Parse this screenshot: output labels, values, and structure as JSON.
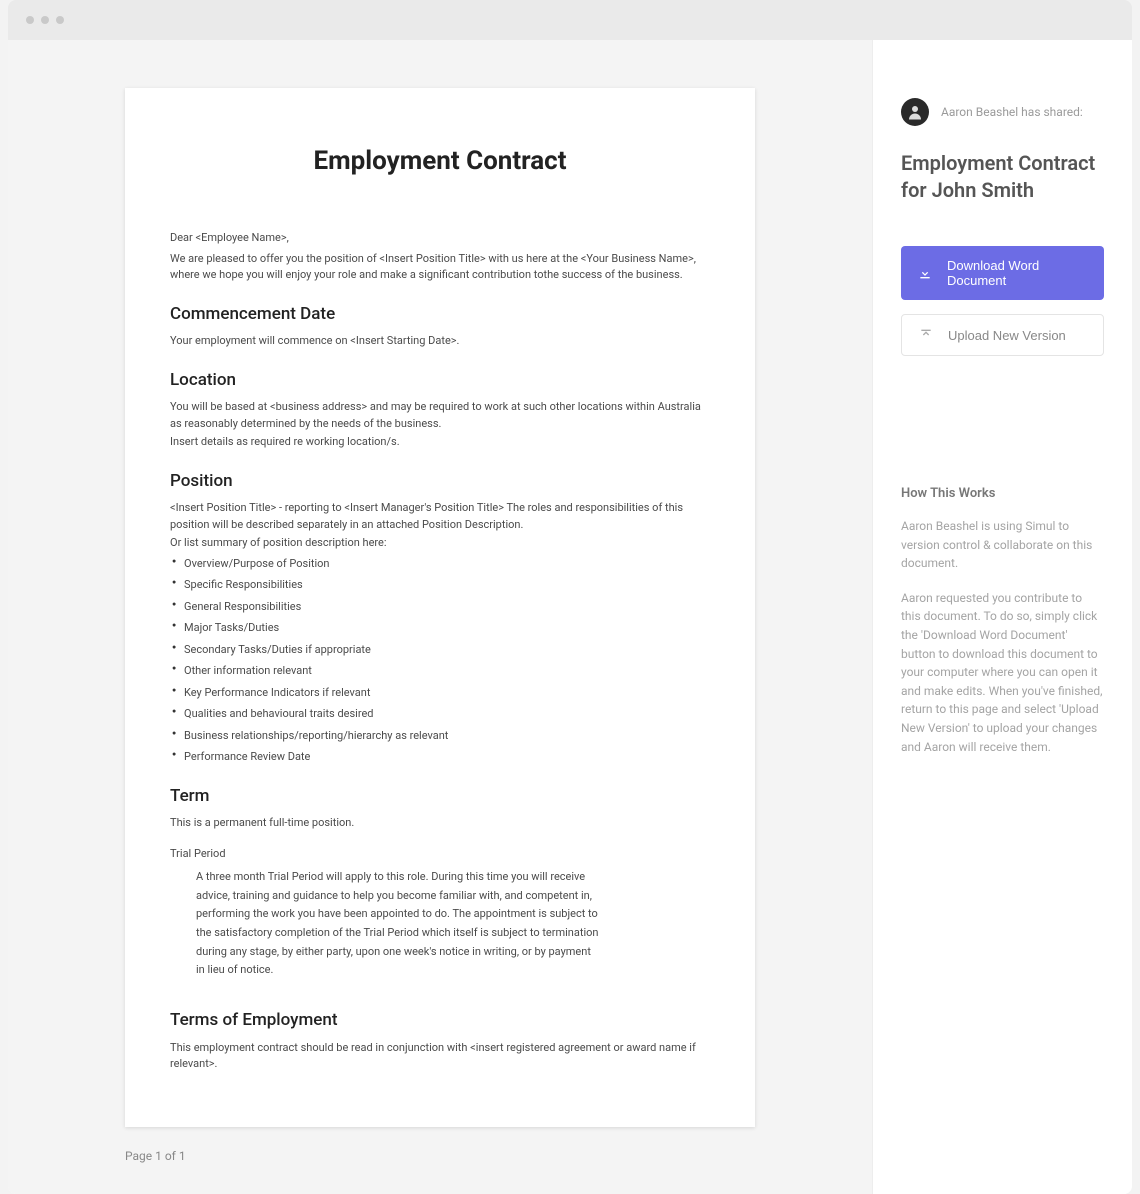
{
  "document": {
    "title": "Employment Contract",
    "greeting": "Dear <Employee Name>,",
    "intro": "We are pleased to offer you the position of <Insert Position Title> with us here at the <Your Business Name>, where we hope you will enjoy your role and make a significant contribution tothe success of the business.",
    "sections": {
      "commencement": {
        "heading": "Commencement Date",
        "text": "Your employment will commence on <Insert Starting Date>."
      },
      "location": {
        "heading": "Location",
        "text1": "You will be based at <business address> and may be required to work at such other locations within Australia as reasonably determined by the needs of the business.",
        "text2": "Insert details as required re working location/s."
      },
      "position": {
        "heading": "Position",
        "text1": "<Insert Position Title> - reporting to <Insert Manager's Position Title> The roles and responsibilities of this position will be described separately in an attached Position Description.",
        "text2": "Or list summary of position description here:",
        "bullets": [
          "Overview/Purpose of Position",
          "Specific Responsibilities",
          "General Responsibilities",
          "Major Tasks/Duties",
          "Secondary Tasks/Duties if appropriate",
          "Other information relevant",
          "Key Performance Indicators if relevant",
          "Qualities and behavioural traits desired",
          "Business relationships/reporting/hierarchy as relevant",
          "Performance Review Date"
        ]
      },
      "term": {
        "heading": "Term",
        "text": "This is a permanent full-time position.",
        "sub_heading": "Trial Period",
        "trial_text": "A three month Trial Period will apply to this role. During this time you will receive advice, training and guidance to help you become familiar with, and competent in, performing the work you have been appointed to do. The appointment is subject to the satisfactory completion of the Trial Period which itself is subject to termination during any stage, by either party, upon one week's notice in writing, or by payment in lieu of notice."
      },
      "terms_employment": {
        "heading": "Terms of Employment",
        "text": "This employment contract should be read in conjunction with <insert registered agreement or award name if relevant>."
      }
    }
  },
  "page_indicator": "Page 1 of 1",
  "sidebar": {
    "shared_by": "Aaron Beashel has shared:",
    "doc_title": "Employment Contract for John Smith",
    "download_label": "Download Word Document",
    "upload_label": "Upload New Version",
    "how_title": "How This Works",
    "how_p1": "Aaron Beashel is using Simul to version control & collaborate on this document.",
    "how_p2": "Aaron requested you contribute to this document. To do so, simply click the 'Download Word Document' button to download this document to your computer where you can open it and make edits. When you've finished, return to this page and select 'Upload New Version' to upload your changes and Aaron will receive them."
  }
}
